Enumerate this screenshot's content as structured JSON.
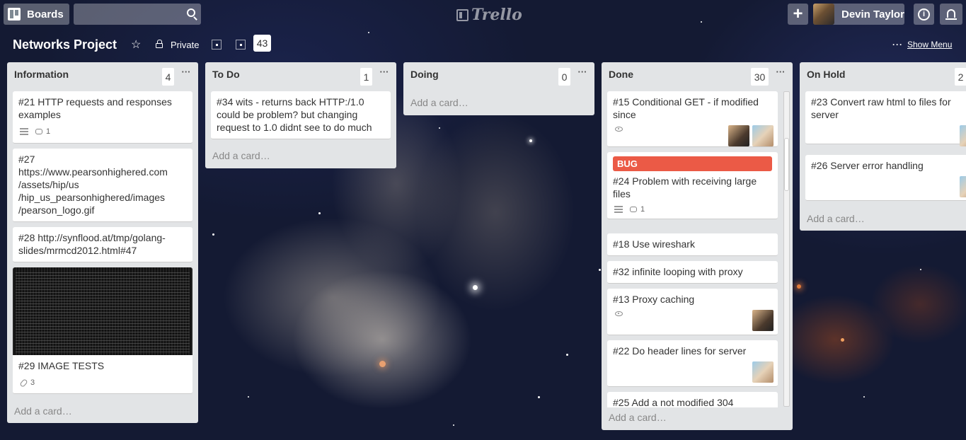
{
  "header": {
    "boards_label": "Boards",
    "search_placeholder": "",
    "logo_text": "Trello",
    "add_label": "+",
    "user_name": "Devin Taylor",
    "info_label": "i"
  },
  "board": {
    "title": "Networks Project",
    "visibility": "Private",
    "count": "43",
    "menu_dots": "···",
    "show_menu": "Show Menu"
  },
  "lists": [
    {
      "title": "Information",
      "count": "4",
      "menu": "···",
      "cards": [
        {
          "text": "#21 HTTP requests and responses examples",
          "comments": "1"
        },
        {
          "text": "#27 https://www.pearsonhighered.com /assets/hip/us /hip_us_pearsonhighered/images /pearson_logo.gif"
        },
        {
          "text": "#28 http://synflood.at/tmp/golang-slides/mrmcd2012.html#47"
        },
        {
          "text": "#29 IMAGE TESTS",
          "attachments": "3"
        }
      ],
      "add_card": "Add a card…"
    },
    {
      "title": "To Do",
      "count": "1",
      "menu": "···",
      "cards": [
        {
          "text": "#34 wits - returns back HTTP:/1.0 could be problem? but changing request to 1.0 didnt see to do much"
        }
      ],
      "add_card": "Add a card…"
    },
    {
      "title": "Doing",
      "count": "0",
      "menu": "···",
      "cards": [],
      "add_card": "Add a card…"
    },
    {
      "title": "Done",
      "count": "30",
      "menu": "···",
      "cards": [
        {
          "text": "#15 Conditional GET - if modified since"
        },
        {
          "label": "BUG",
          "text": "#24 Problem with receiving large files",
          "comments": "1"
        },
        {
          "text": "#18 Use wireshark"
        },
        {
          "text": "#32 infinite looping with proxy"
        },
        {
          "text": "#13 Proxy caching"
        },
        {
          "text": "#22 Do header lines for server"
        },
        {
          "text": "#25 Add a not modified 304"
        }
      ],
      "add_card": "Add a card…"
    },
    {
      "title": "On Hold",
      "count": "2",
      "menu": "···",
      "cards": [
        {
          "text": "#23 Convert raw html to files for server"
        },
        {
          "text": "#26 Server error handling"
        }
      ],
      "add_card": "Add a card…"
    }
  ],
  "colors": {
    "label_bug": "#eb5a46",
    "list_bg": "#e2e4e6"
  }
}
